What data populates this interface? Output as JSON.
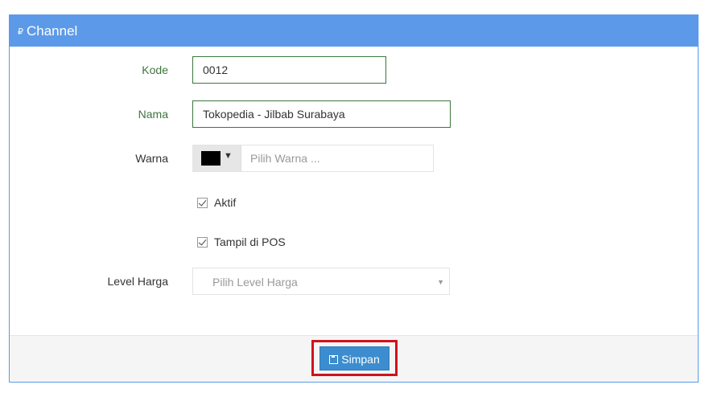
{
  "header": {
    "title": "Channel",
    "icon": "tag-icon"
  },
  "form": {
    "kode": {
      "label": "Kode",
      "value": "0012"
    },
    "nama": {
      "label": "Nama",
      "value": "Tokopedia - Jilbab Surabaya"
    },
    "warna": {
      "label": "Warna",
      "placeholder": "Pilih Warna ...",
      "selected_color": "#000000"
    },
    "aktif": {
      "label": "Aktif",
      "checked": true
    },
    "tampil_pos": {
      "label": "Tampil di POS",
      "checked": true
    },
    "level_harga": {
      "label": "Level Harga",
      "placeholder": "Pilih Level Harga"
    }
  },
  "footer": {
    "save_label": "Simpan"
  },
  "colors": {
    "header_bg": "#5c9ae9",
    "success_label": "#3c763d",
    "button_bg": "#3c8dcf",
    "highlight": "#d0121b"
  }
}
